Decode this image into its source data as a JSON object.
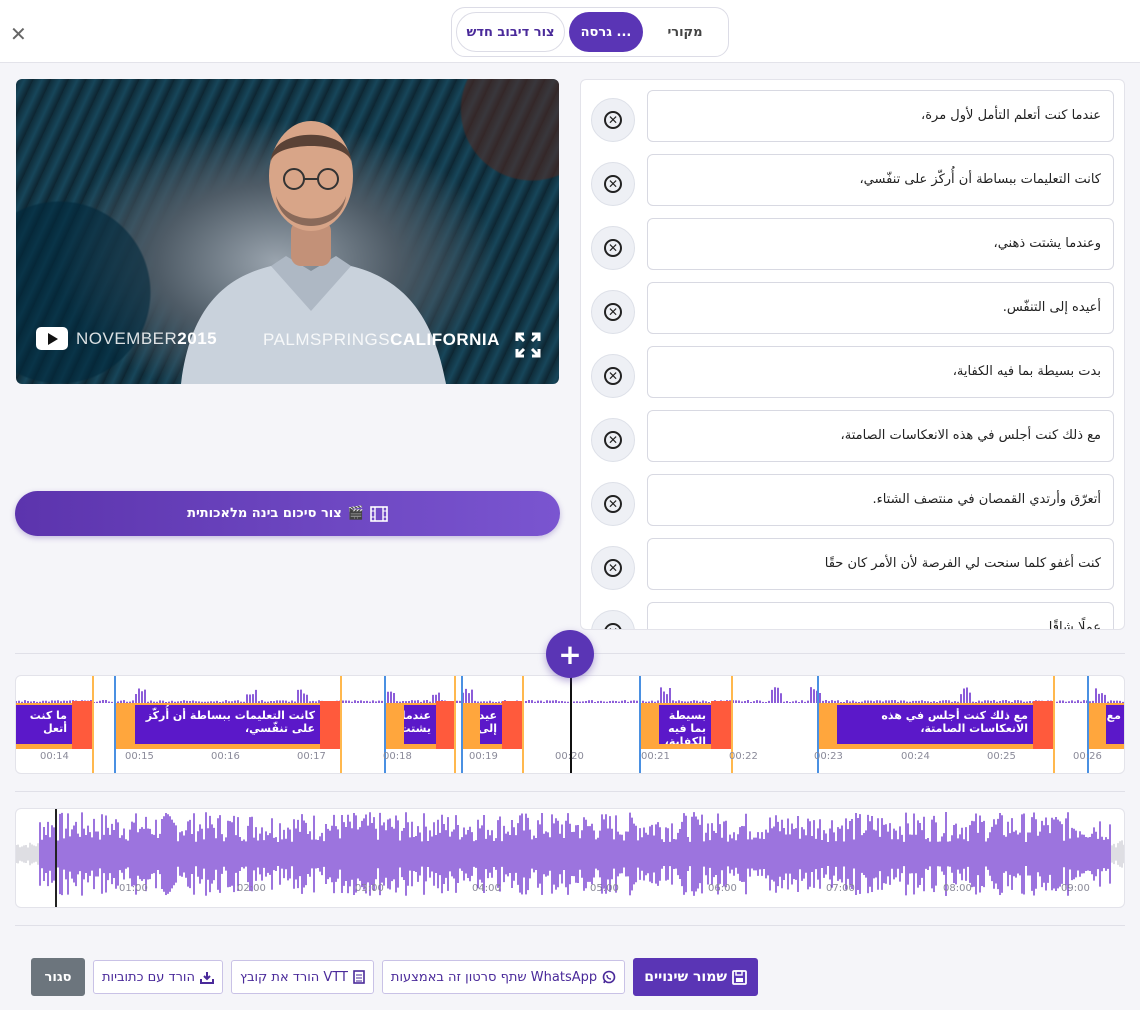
{
  "header": {
    "close_icon": "close-icon",
    "tabs": [
      {
        "label": "צור דיבוב חדש",
        "state": "outline"
      },
      {
        "label": "גרסה ...",
        "state": "active"
      },
      {
        "label": "מקורי",
        "state": "plain"
      }
    ]
  },
  "video": {
    "overlay_left_light": "NOVEMBER",
    "overlay_left_bold": "2015",
    "overlay_right_light": "PALMSPRINGS",
    "overlay_right_bold": "CALIFORNIA",
    "play_icon": "youtube-icon",
    "fullscreen_icon": "fullscreen-icon"
  },
  "ai_button": {
    "label": "צור סיכום בינה מלאכותית",
    "icons": [
      "clapperboard-icon",
      "film-icon"
    ]
  },
  "subtitles": [
    "عندما كنت أتعلم التأمل لأول مرة،",
    "كانت التعليمات ببساطة أن أُركّز على تنفّسي،",
    "وعندما يشتت ذهني،",
    "أعيده إلى التنفّس.",
    "بدت بسيطة بما فيه الكفاية،",
    "مع ذلك كنت أجلس في هذه الانعكاسات الصامتة،",
    "أتعرّق وأرتدي القمصان في منتصف الشتاء.",
    "كنت أغفو كلما سنحت لي الفرصة لأن الأمر كان حقًا",
    "عملًا شاقًا"
  ],
  "add_button_icon": "plus-icon",
  "timeline": {
    "ticks": [
      "00:14",
      "00:15",
      "00:16",
      "00:17",
      "00:18",
      "00:19",
      "00:20",
      "00:21",
      "00:22",
      "00:23",
      "00:24",
      "00:25",
      "00:26"
    ],
    "segments": [
      {
        "text": "ما كنت أتعل"
      },
      {
        "text": "كانت التعليمات ببساطة أن أُركّز على تنفّسي،"
      },
      {
        "text": "عندما يشتت"
      },
      {
        "text": "عيده إلى"
      },
      {
        "text": "بسيطة بما فيه الكفاية،"
      },
      {
        "text": "مع ذلك كنت أجلس في هذه الانعكاسات الصامتة،"
      },
      {
        "text": "مع"
      }
    ],
    "playhead_time": "00:20"
  },
  "waveform": {
    "ticks": [
      "01:00",
      "02:00",
      "03:00",
      "04:00",
      "05:00",
      "06:00",
      "07:00",
      "08:00",
      "09:00"
    ],
    "color": "#5b18c9"
  },
  "footer": {
    "close_label": "סגור",
    "download_subs_label": "הורד עם כתוביות",
    "download_vtt_label": "הורד את קובץ VTT",
    "share_whatsapp_label": "שתף סרטון זה באמצעות WhatsApp",
    "save_label": "שמור שינויים"
  },
  "colors": {
    "accent": "#5a35b5",
    "segment_orange": "#ffa63d",
    "segment_red": "#ff5a3c",
    "segment_purple": "#5b18c9"
  }
}
